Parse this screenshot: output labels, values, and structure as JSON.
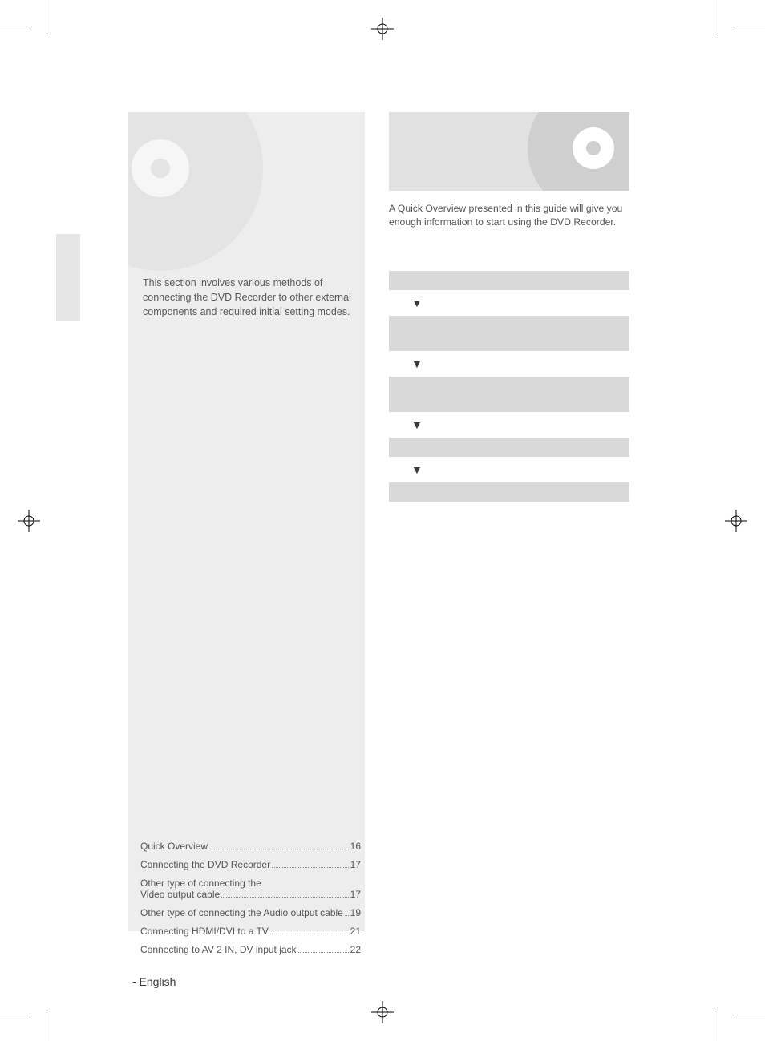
{
  "left": {
    "intro": "This section involves various methods of connecting the DVD Recorder to other external components and required initial setting modes."
  },
  "toc": [
    {
      "label": "Quick Overview",
      "page": "16"
    },
    {
      "label": "Connecting the DVD Recorder",
      "page": "17"
    },
    {
      "label_line1": "Other type of connecting the",
      "label_line2": "Video output cable",
      "page": "17",
      "multiline": true
    },
    {
      "label": "Other type of connecting the Audio output cable",
      "page": "19"
    },
    {
      "label": "Connecting HDMI/DVI to a TV",
      "page": "21"
    },
    {
      "label": "Connecting to AV 2 IN, DV input jack",
      "page": "22"
    }
  ],
  "right": {
    "intro": "A Quick Overview presented in this guide will give you enough information to start using the DVD Recorder."
  },
  "arrow_glyph": "▼",
  "footer": {
    "lang": "- English"
  }
}
